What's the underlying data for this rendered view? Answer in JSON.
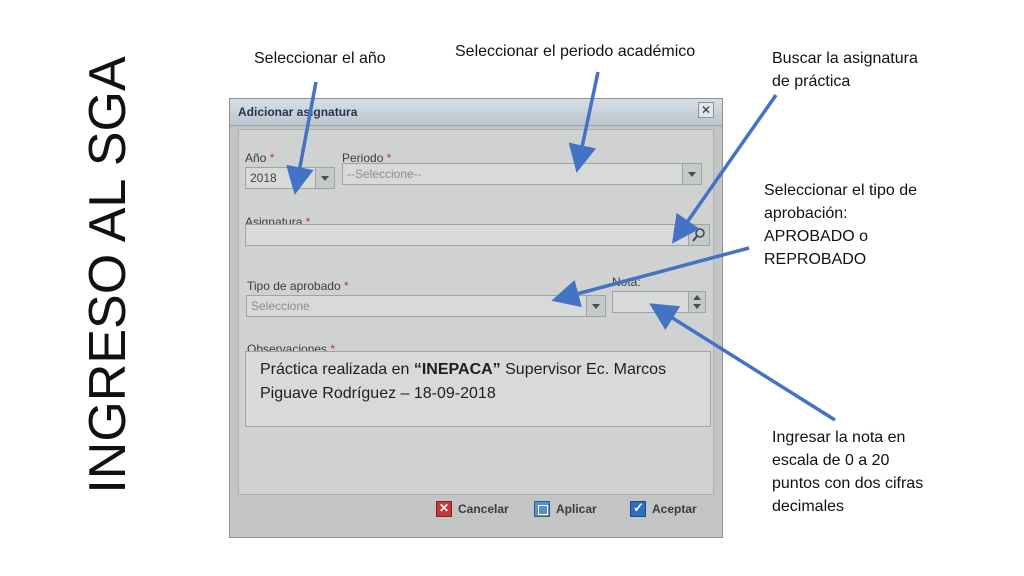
{
  "slide": {
    "title": "INGRESO AL SGA",
    "notes": {
      "year": "Seleccionar el año",
      "period": "Seleccionar el periodo académico",
      "subject_line1": "Buscar la asignatura",
      "subject_line2": "de práctica",
      "approval_line1": "Seleccionar el tipo de",
      "approval_line2": "aprobación:",
      "approval_line3": "APROBADO o",
      "approval_line4": "REPROBADO",
      "grade_line1": "Ingresar la nota en",
      "grade_line2": "escala de 0 a 20",
      "grade_line3": "puntos con dos cifras",
      "grade_line4": "decimales"
    },
    "arrow_color": "#4472c4"
  },
  "dialog": {
    "title": "Adicionar asignatura",
    "close_glyph": "✕",
    "required_mark": "*",
    "fields": {
      "year": {
        "label": "Año",
        "value": "2018"
      },
      "period": {
        "label": "Periodo",
        "value": "--Seleccione--"
      },
      "subject": {
        "label": "Asignatura",
        "value": ""
      },
      "approval_type": {
        "label": "Tipo de aprobado",
        "value": "Seleccione"
      },
      "grade": {
        "label": "Nota:",
        "value": ""
      },
      "observations": {
        "label": "Observaciones",
        "text_before": "Práctica realizada en ",
        "text_bold": "“INEPACA”",
        "text_after": " Supervisor Ec. Marcos Piguave Rodríguez – 18-09-2018"
      }
    },
    "buttons": {
      "cancel": "Cancelar",
      "apply": "Aplicar",
      "accept": "Aceptar"
    },
    "icons": {
      "dropdown": "chevron-down-icon",
      "search": "search-icon",
      "spinner": "spinner-icon",
      "cancel": "cancel-icon",
      "apply": "apply-icon",
      "accept": "accept-icon"
    }
  }
}
